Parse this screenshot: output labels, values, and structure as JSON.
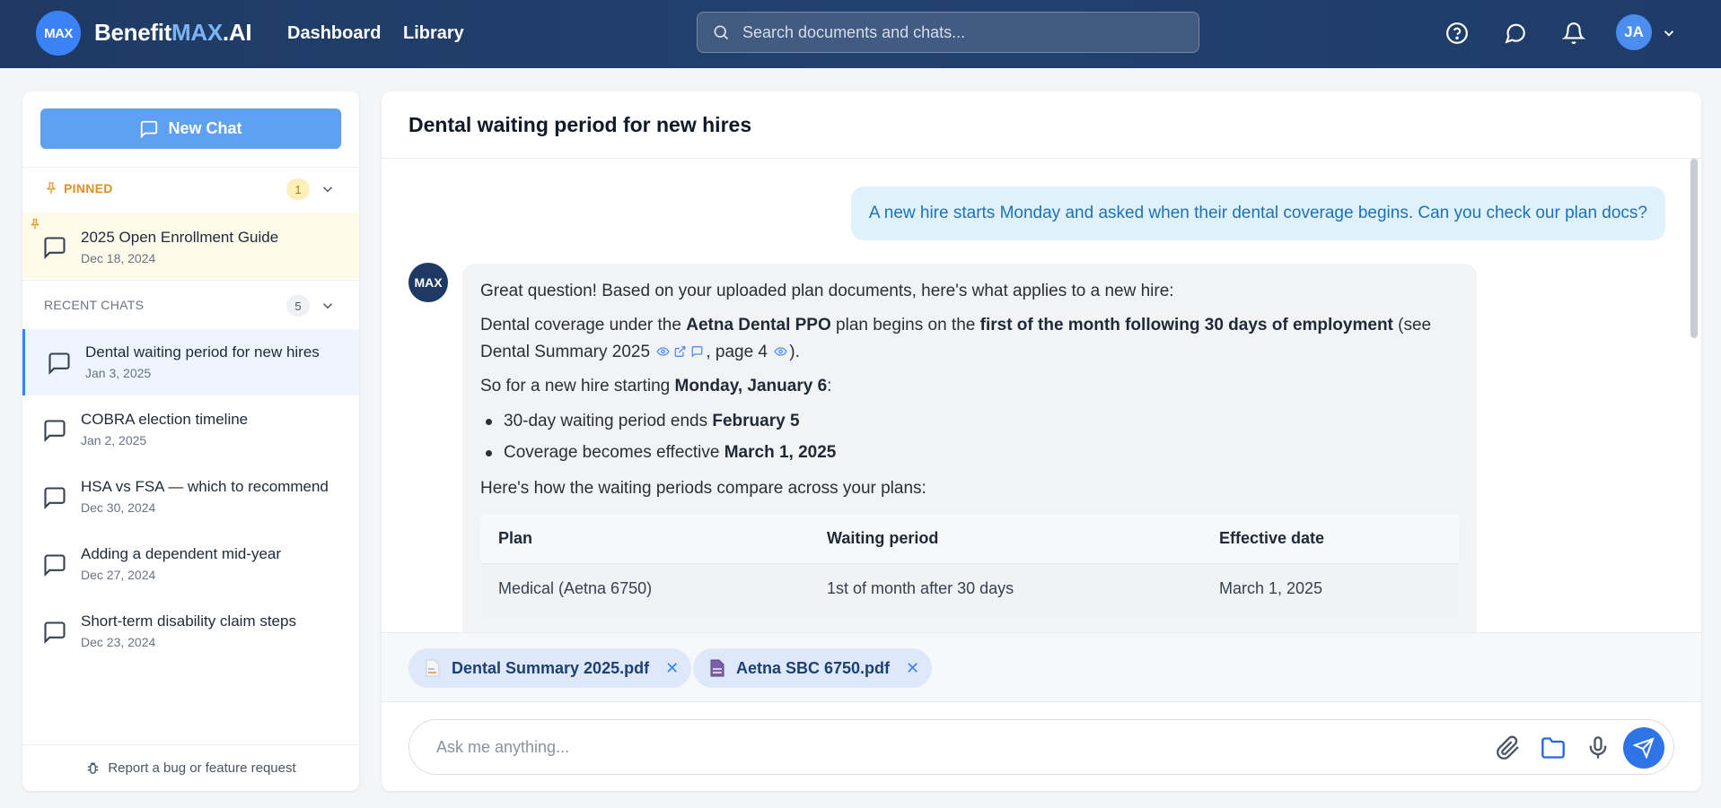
{
  "header": {
    "logo_badge": "MAX",
    "brand_prefix": "Benefit",
    "brand_highlight": "MAX",
    "brand_suffix": ".AI",
    "nav": [
      "Dashboard",
      "Library"
    ],
    "search_placeholder": "Search documents and chats...",
    "user_initials": "JA"
  },
  "sidebar": {
    "new_chat_label": "New Chat",
    "pinned": {
      "label": "PINNED",
      "count": "1",
      "items": [
        {
          "title": "2025 Open Enrollment Guide",
          "date": "Dec 18, 2024"
        }
      ]
    },
    "recent": {
      "label": "RECENT CHATS",
      "count": "5",
      "items": [
        {
          "title": "Dental waiting period for new hires",
          "date": "Jan 3, 2025"
        },
        {
          "title": "COBRA election timeline",
          "date": "Jan 2, 2025"
        },
        {
          "title": "HSA vs FSA — which to recommend",
          "date": "Dec 30, 2024"
        },
        {
          "title": "Adding a dependent mid-year",
          "date": "Dec 27, 2024"
        },
        {
          "title": "Short-term disability claim steps",
          "date": "Dec 23, 2024"
        }
      ]
    },
    "footer_label": "Report a bug or feature request"
  },
  "conversation": {
    "title": "Dental waiting period for new hires",
    "user_message": "A new hire starts Monday and asked when their dental coverage begins. Can you check our plan docs?",
    "bot_avatar": "MAX",
    "bot": {
      "intro": "Great question! Based on your uploaded plan documents, here's what applies to a new hire:",
      "p2_a": "Dental coverage under the ",
      "p2_b": "Aetna Dental PPO",
      "p2_c": " plan begins on the ",
      "p2_d": "first of the month following 30 days of employment",
      "p2_e": " (see Dental Summary 2025 ",
      "p2_f": ", page 4 ",
      "p2_g": ").",
      "p3_a": "So for a new hire starting ",
      "p3_b": "Monday, January 6",
      "p3_c": ":",
      "bullets": [
        {
          "text": "30-day waiting period ends ",
          "bold": "February 5"
        },
        {
          "text": "Coverage becomes effective ",
          "bold": "March 1, 2025"
        }
      ],
      "p4": "Here's how the waiting periods compare across your plans:",
      "table": {
        "headers": [
          "Plan",
          "Waiting period",
          "Effective date"
        ],
        "rows": [
          [
            "Medical (Aetna 6750)",
            "1st of month after 30 days",
            "March 1, 2025"
          ]
        ]
      }
    }
  },
  "attachments": [
    {
      "name": "Dental Summary 2025.pdf"
    },
    {
      "name": "Aetna SBC 6750.pdf"
    }
  ],
  "composer": {
    "placeholder": "Ask me anything..."
  }
}
